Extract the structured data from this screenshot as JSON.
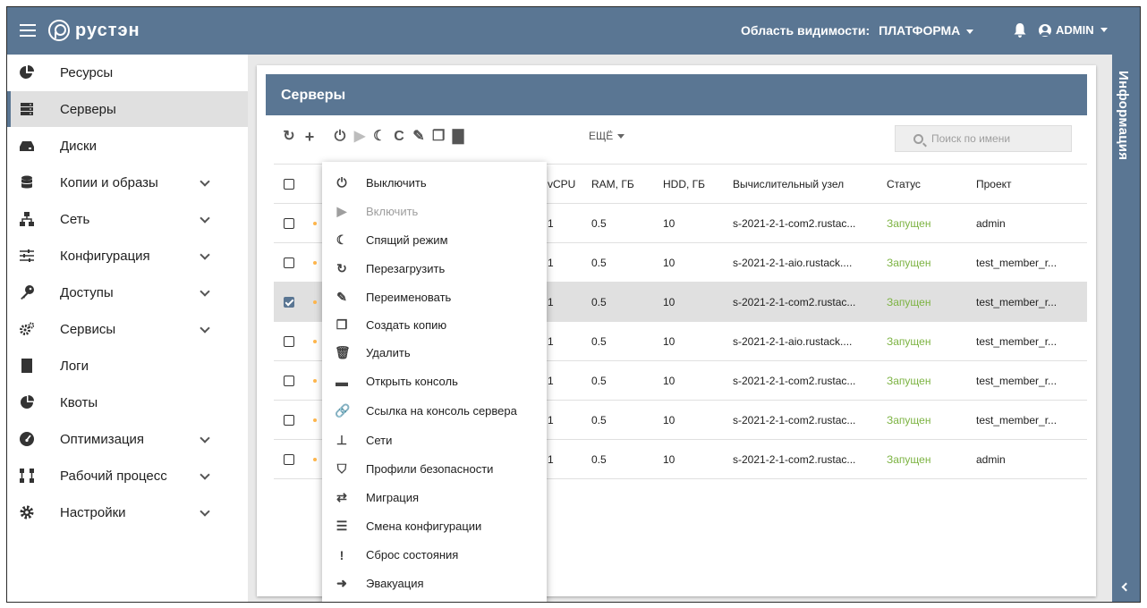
{
  "app": {
    "logo": "рустэн",
    "scope_label": "Область видимости:",
    "scope_value": "ПЛАТФОРМА",
    "user": "ADMIN"
  },
  "sidebar": {
    "items": [
      {
        "label": "Ресурсы",
        "icon": "pie-chart-icon",
        "chevron": false
      },
      {
        "label": "Серверы",
        "icon": "server-icon",
        "chevron": false,
        "active": true
      },
      {
        "label": "Диски",
        "icon": "disk-icon",
        "chevron": false
      },
      {
        "label": "Копии и образы",
        "icon": "database-icon",
        "chevron": true
      },
      {
        "label": "Сеть",
        "icon": "network-icon",
        "chevron": true
      },
      {
        "label": "Конфигурация",
        "icon": "sliders-icon",
        "chevron": true
      },
      {
        "label": "Доступы",
        "icon": "key-icon",
        "chevron": true
      },
      {
        "label": "Сервисы",
        "icon": "cogs-icon",
        "chevron": true
      },
      {
        "label": "Логи",
        "icon": "book-icon",
        "chevron": false
      },
      {
        "label": "Квоты",
        "icon": "quota-pie-icon",
        "chevron": false
      },
      {
        "label": "Оптимизация",
        "icon": "gauge-icon",
        "chevron": true
      },
      {
        "label": "Рабочий процесс",
        "icon": "workflow-icon",
        "chevron": true
      },
      {
        "label": "Настройки",
        "icon": "gear-icon",
        "chevron": true
      }
    ]
  },
  "main": {
    "title": "Серверы",
    "more_label": "ЕЩЁ",
    "search_placeholder": "Поиск по имени",
    "columns": [
      "vCPU",
      "RAM, ГБ",
      "HDD, ГБ",
      "Вычислительный узел",
      "Статус",
      "Проект"
    ],
    "rows": [
      {
        "vcpu": "1",
        "ram": "0.5",
        "hdd": "10",
        "node": "s-2021-2-1-com2.rustac...",
        "status": "Запущен",
        "project": "admin",
        "selected": false
      },
      {
        "vcpu": "1",
        "ram": "0.5",
        "hdd": "10",
        "node": "s-2021-2-1-aio.rustack....",
        "status": "Запущен",
        "project": "test_member_r...",
        "selected": false
      },
      {
        "vcpu": "1",
        "ram": "0.5",
        "hdd": "10",
        "node": "s-2021-2-1-com2.rustac...",
        "status": "Запущен",
        "project": "test_member_r...",
        "selected": true
      },
      {
        "vcpu": "1",
        "ram": "0.5",
        "hdd": "10",
        "node": "s-2021-2-1-aio.rustack....",
        "status": "Запущен",
        "project": "test_member_r...",
        "selected": false
      },
      {
        "vcpu": "1",
        "ram": "0.5",
        "hdd": "10",
        "node": "s-2021-2-1-com2.rustac...",
        "status": "Запущен",
        "project": "test_member_r...",
        "selected": false
      },
      {
        "vcpu": "1",
        "ram": "0.5",
        "hdd": "10",
        "node": "s-2021-2-1-com2.rustac...",
        "status": "Запущен",
        "project": "test_member_r...",
        "selected": false
      },
      {
        "vcpu": "1",
        "ram": "0.5",
        "hdd": "10",
        "node": "s-2021-2-1-com2.rustac...",
        "status": "Запущен",
        "project": "admin",
        "selected": false
      }
    ]
  },
  "context_menu": {
    "items": [
      {
        "label": "Выключить",
        "icon": "power-off-icon",
        "glyph": "⏻",
        "disabled": false
      },
      {
        "label": "Включить",
        "icon": "play-icon",
        "glyph": "▶",
        "disabled": true
      },
      {
        "label": "Спящий режим",
        "icon": "moon-icon",
        "glyph": "☾",
        "disabled": false
      },
      {
        "label": "Перезагрузить",
        "icon": "restart-icon",
        "glyph": "↻",
        "disabled": false
      },
      {
        "label": "Переименовать",
        "icon": "edit-icon",
        "glyph": "✎",
        "disabled": false
      },
      {
        "label": "Создать копию",
        "icon": "copy-icon",
        "glyph": "❐",
        "disabled": false
      },
      {
        "label": "Удалить",
        "icon": "trash-icon",
        "glyph": "🗑",
        "disabled": false
      },
      {
        "label": "Открыть консоль",
        "icon": "console-icon",
        "glyph": "▬",
        "disabled": false
      },
      {
        "label": "Ссылка на консоль сервера",
        "icon": "link-icon",
        "glyph": "🔗",
        "disabled": false
      },
      {
        "label": "Сети",
        "icon": "sitemap-icon",
        "glyph": "⊥",
        "disabled": false
      },
      {
        "label": "Профили безопасности",
        "icon": "shield-icon",
        "glyph": "⛉",
        "disabled": false
      },
      {
        "label": "Миграция",
        "icon": "exchange-icon",
        "glyph": "⇄",
        "disabled": false
      },
      {
        "label": "Смена конфигурации",
        "icon": "sliders-icon",
        "glyph": "☰",
        "disabled": false
      },
      {
        "label": "Сброс состояния",
        "icon": "exclamation-icon",
        "glyph": "!",
        "disabled": false
      },
      {
        "label": "Эвакуация",
        "icon": "sign-in-icon",
        "glyph": "➜",
        "disabled": false
      }
    ]
  },
  "right_panel": {
    "title": "Информация"
  },
  "colors": {
    "primary": "#5a7693",
    "status_running": "#7cb342",
    "selected_row": "#e0e0e0"
  }
}
